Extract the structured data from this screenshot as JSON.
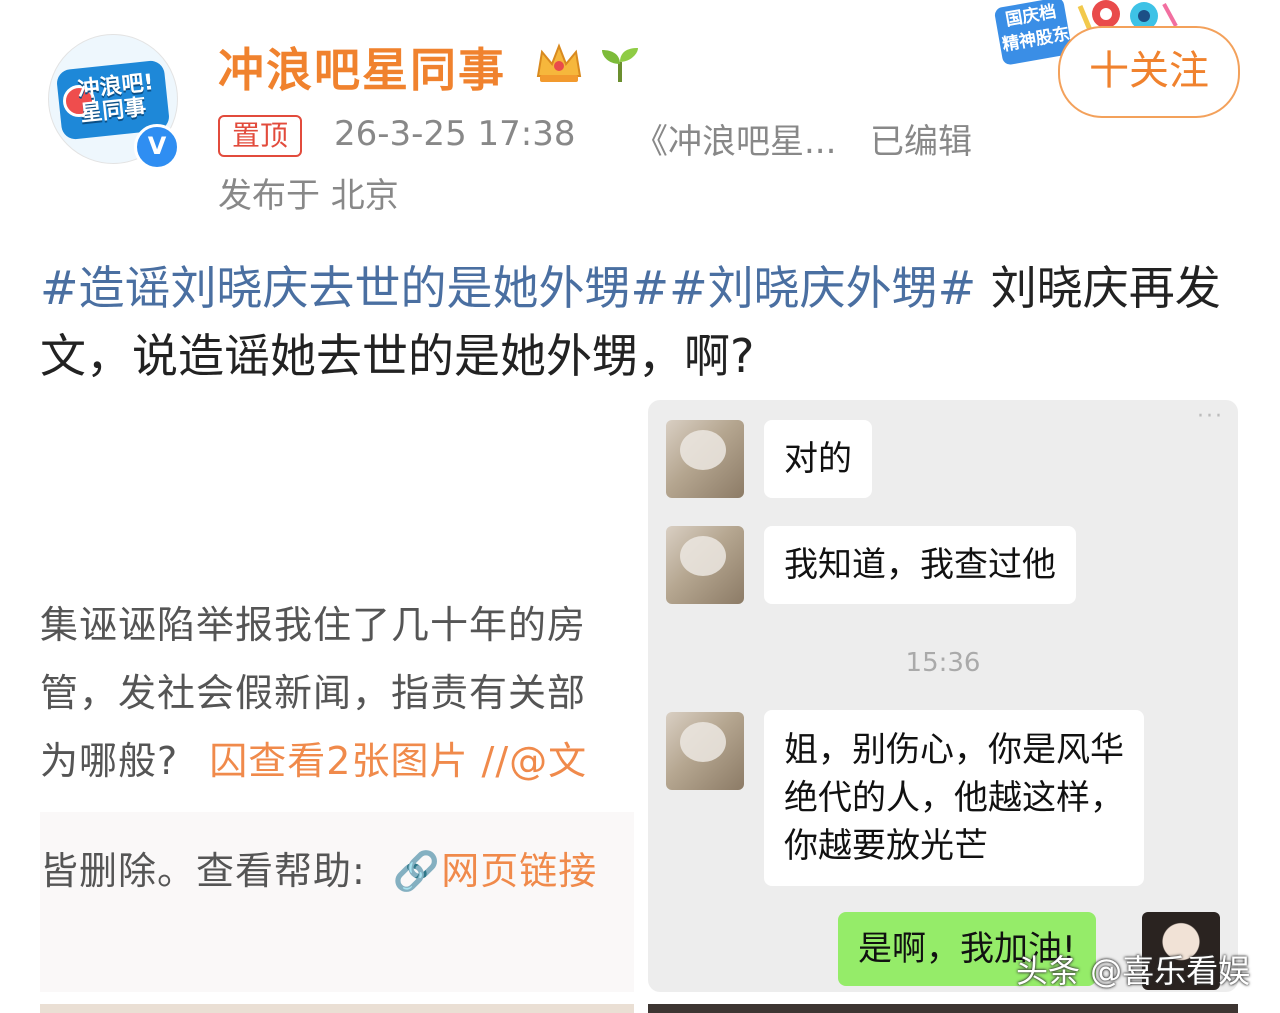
{
  "account": {
    "username": "冲浪吧星同事",
    "avatar_text": "冲浪吧!\n星同事",
    "verified_mark": "V"
  },
  "post": {
    "pin_label": "置顶",
    "timestamp": "26-3-25 17:38",
    "source": "《冲浪吧星...",
    "edited_label": "已编辑",
    "location": "发布于 北京",
    "hashtag1": "#造谣刘晓庆去世的是她外甥#",
    "hashtag2": "#刘晓庆外甥#",
    "text_rest": " 刘晓庆再发文，说造谣她去世的是她外甥，啊?"
  },
  "header": {
    "event_badge": "国庆档\n精神股东",
    "follow_label": "十关注"
  },
  "left_screenshot": {
    "line1": "集诬诬陷举报我住了几十年的房",
    "line2": "管，发社会假新闻，指责有关部",
    "line3_prefix": "为哪般?",
    "line3_link": "囚查看2张图片 //@文",
    "line4_prefix": "皆删除。查看帮助:",
    "line4_link": "🔗网页链接"
  },
  "chat": {
    "messages": [
      {
        "text": "对的"
      },
      {
        "text": "我知道，我查过他"
      },
      {
        "text": "姐，别伤心，你是风华\n绝代的人，他越这样，\n你越要放光芒"
      },
      {
        "text": "是啊，我加油!"
      }
    ],
    "time": "15:36"
  },
  "watermark": "头条 @喜乐看娱",
  "colors": {
    "username": "#f0822e",
    "hashtag": "#4a6fa1",
    "pin": "#e24b3c",
    "chat_bg": "#ededed",
    "bubble_self": "#95ec69"
  },
  "icons": [
    "crown-icon",
    "sprout-icon",
    "verified-icon",
    "image-icon",
    "link-icon"
  ]
}
